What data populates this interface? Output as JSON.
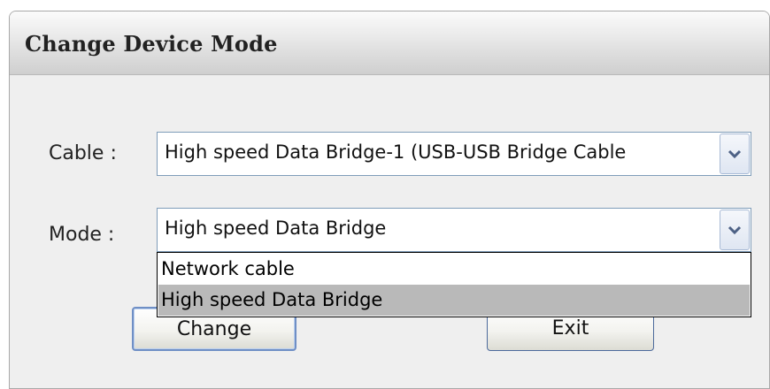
{
  "window": {
    "title": "Change Device Mode"
  },
  "cable": {
    "label": "Cable :",
    "value": "High speed Data Bridge-1 (USB-USB Bridge Cable"
  },
  "mode": {
    "label": "Mode :",
    "value": "High speed Data Bridge",
    "options": [
      {
        "label": "Network cable",
        "selected": false
      },
      {
        "label": "High speed Data Bridge",
        "selected": true
      }
    ]
  },
  "buttons": {
    "change_label": "Change",
    "exit_label": "Exit"
  },
  "icons": {
    "dropdown": "chevron-down-icon"
  }
}
